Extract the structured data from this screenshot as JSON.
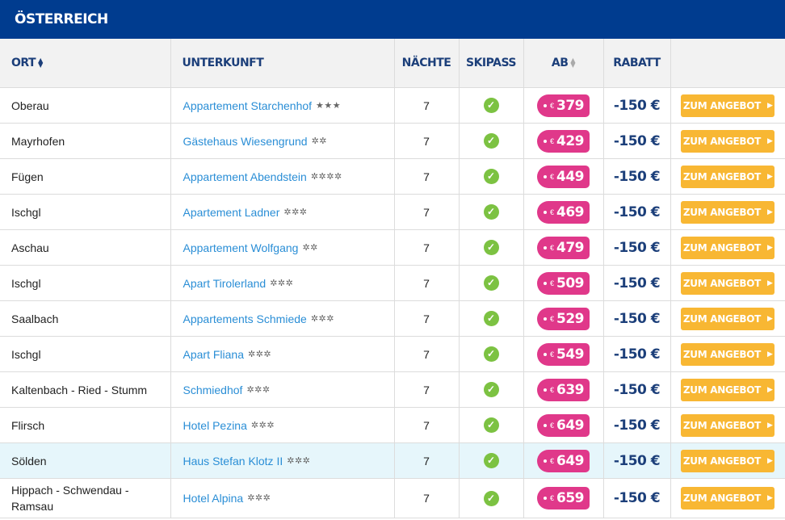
{
  "title": "ÖSTERREICH",
  "headers": {
    "ort": "ORT",
    "unterkunft": "UNTERKUNFT",
    "naechte": "NÄCHTE",
    "skipass": "SKIPASS",
    "ab": "AB",
    "rabatt": "RABATT"
  },
  "currency": "€",
  "button_label": "ZUM ANGEBOT",
  "colors": {
    "header": "#003c8f",
    "price_tag": "#e0388a",
    "button": "#f8b733",
    "check": "#7cc242",
    "link": "#2a8ed6",
    "rabatt": "#1c3f7a",
    "highlight_row": "#e6f6fb"
  },
  "rows": [
    {
      "ort": "Oberau",
      "unterkunft": "Appartement Starchenhof",
      "stars": "★★★",
      "naechte": "7",
      "skipass": true,
      "ab": "379",
      "rabatt": "-150 €"
    },
    {
      "ort": "Mayrhofen",
      "unterkunft": "Gästehaus Wiesengrund",
      "stars": "✲✲",
      "naechte": "7",
      "skipass": true,
      "ab": "429",
      "rabatt": "-150 €"
    },
    {
      "ort": "Fügen",
      "unterkunft": "Appartement Abendstein",
      "stars": "✲✲✲✲",
      "naechte": "7",
      "skipass": true,
      "ab": "449",
      "rabatt": "-150 €"
    },
    {
      "ort": "Ischgl",
      "unterkunft": "Apartement Ladner",
      "stars": "✲✲✲",
      "naechte": "7",
      "skipass": true,
      "ab": "469",
      "rabatt": "-150 €"
    },
    {
      "ort": "Aschau",
      "unterkunft": "Appartement Wolfgang",
      "stars": "✲✲",
      "naechte": "7",
      "skipass": true,
      "ab": "479",
      "rabatt": "-150 €"
    },
    {
      "ort": "Ischgl",
      "unterkunft": "Apart Tirolerland",
      "stars": "✲✲✲",
      "naechte": "7",
      "skipass": true,
      "ab": "509",
      "rabatt": "-150 €"
    },
    {
      "ort": "Saalbach",
      "unterkunft": "Appartements Schmiede",
      "stars": "✲✲✲",
      "naechte": "7",
      "skipass": true,
      "ab": "529",
      "rabatt": "-150 €"
    },
    {
      "ort": "Ischgl",
      "unterkunft": "Apart Fliana",
      "stars": "✲✲✲",
      "naechte": "7",
      "skipass": true,
      "ab": "549",
      "rabatt": "-150 €"
    },
    {
      "ort": "Kaltenbach - Ried - Stumm",
      "unterkunft": "Schmiedhof",
      "stars": "✲✲✲",
      "naechte": "7",
      "skipass": true,
      "ab": "639",
      "rabatt": "-150 €"
    },
    {
      "ort": "Flirsch",
      "unterkunft": "Hotel Pezina",
      "stars": "✲✲✲",
      "naechte": "7",
      "skipass": true,
      "ab": "649",
      "rabatt": "-150 €"
    },
    {
      "ort": "Sölden",
      "unterkunft": "Haus Stefan Klotz II",
      "stars": "✲✲✲",
      "naechte": "7",
      "skipass": true,
      "ab": "649",
      "rabatt": "-150 €",
      "highlight": true
    },
    {
      "ort": "Hippach - Schwendau - Ramsau",
      "unterkunft": "Hotel Alpina",
      "stars": "✲✲✲",
      "naechte": "7",
      "skipass": true,
      "ab": "659",
      "rabatt": "-150 €"
    }
  ]
}
